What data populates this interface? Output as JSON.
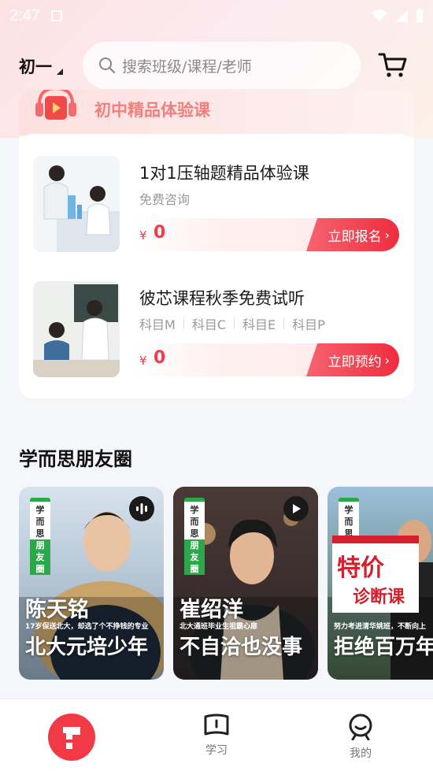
{
  "status_bar": {
    "time": "2:47"
  },
  "header": {
    "grade": "初一",
    "search_placeholder": "搜索班级/课程/老师"
  },
  "experience": {
    "title": "初中精品体验课",
    "courses": [
      {
        "name": "1对1压轴题精品体验课",
        "subtitle": "免费咨询",
        "currency": "¥",
        "price": "0",
        "cta": "立即报名"
      },
      {
        "name": "彼芯课程秋季免费试听",
        "subjects": [
          "科目M",
          "科目C",
          "科目E",
          "科目P"
        ],
        "currency": "¥",
        "price": "0",
        "cta": "立即预约"
      }
    ]
  },
  "moments": {
    "title": "学而思朋友圈",
    "badge": [
      "学",
      "而",
      "思",
      "朋",
      "友",
      "圈"
    ],
    "cards": [
      {
        "name": "陈天铭",
        "tagline": "17岁保送北大，却选了个不挣钱的专业",
        "headline": "北大元培少年",
        "media": "audio-icon"
      },
      {
        "name": "崔绍洋",
        "tagline": "北大通班毕业生祖霸心扉",
        "headline": "不自洽也没事",
        "media": "play-icon"
      },
      {
        "promo_title": "特价",
        "promo_sub": "诊断课",
        "tagline": "努力考进清华姚班，不断向上",
        "headline": "拒绝百万年"
      }
    ]
  },
  "nav": {
    "study": "学习",
    "mine": "我的"
  },
  "colors": {
    "brand_red": "#ee2d3f",
    "accent_green": "#2aa84a"
  }
}
